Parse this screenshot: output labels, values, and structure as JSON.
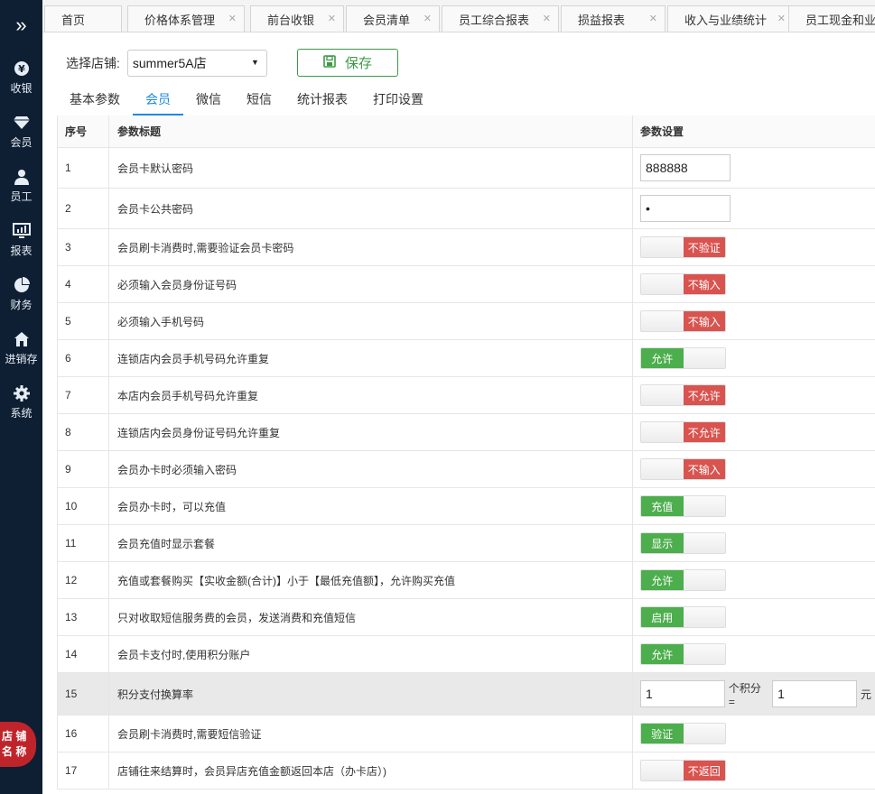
{
  "sidebar": {
    "toggle": "»",
    "items": [
      {
        "label": "收银",
        "icon": "yen-coin-icon"
      },
      {
        "label": "会员",
        "icon": "diamond-icon"
      },
      {
        "label": "员工",
        "icon": "person-icon"
      },
      {
        "label": "报表",
        "icon": "monitor-chart-icon"
      },
      {
        "label": "财务",
        "icon": "pie-chart-icon"
      },
      {
        "label": "进销存",
        "icon": "house-icon"
      },
      {
        "label": "系统",
        "icon": "gear-icon"
      }
    ],
    "store_badge": [
      "店 铺",
      "名 称"
    ]
  },
  "tabs": [
    {
      "label": "首页"
    },
    {
      "label": "价格体系管理"
    },
    {
      "label": "前台收银"
    },
    {
      "label": "会员清单"
    },
    {
      "label": "员工综合报表"
    },
    {
      "label": "损益报表"
    },
    {
      "label": "收入与业绩统计"
    },
    {
      "label": "员工现金和业绩"
    }
  ],
  "toolbar": {
    "store_label": "选择店铺:",
    "store_value": "summer5A店",
    "save_label": "保存"
  },
  "subtabs": [
    {
      "label": "基本参数",
      "active": false
    },
    {
      "label": "会员",
      "active": true
    },
    {
      "label": "微信",
      "active": false
    },
    {
      "label": "短信",
      "active": false
    },
    {
      "label": "统计报表",
      "active": false
    },
    {
      "label": "打印设置",
      "active": false
    }
  ],
  "table": {
    "headers": {
      "no": "序号",
      "title": "参数标题",
      "setting": "参数设置"
    },
    "rows": [
      {
        "no": "1",
        "title": "会员卡默认密码",
        "type": "text",
        "value": "888888"
      },
      {
        "no": "2",
        "title": "会员卡公共密码",
        "type": "text",
        "value": "•"
      },
      {
        "no": "3",
        "title": "会员刷卡消费时,需要验证会员卡密码",
        "type": "switch",
        "state": "off",
        "label": "不验证"
      },
      {
        "no": "4",
        "title": "必须输入会员身份证号码",
        "type": "switch",
        "state": "off",
        "label": "不输入"
      },
      {
        "no": "5",
        "title": "必须输入手机号码",
        "type": "switch",
        "state": "off",
        "label": "不输入"
      },
      {
        "no": "6",
        "title": "连锁店内会员手机号码允许重复",
        "type": "switch",
        "state": "on",
        "label": "允许"
      },
      {
        "no": "7",
        "title": "本店内会员手机号码允许重复",
        "type": "switch",
        "state": "off",
        "label": "不允许"
      },
      {
        "no": "8",
        "title": "连锁店内会员身份证号码允许重复",
        "type": "switch",
        "state": "off",
        "label": "不允许"
      },
      {
        "no": "9",
        "title": "会员办卡时必须输入密码",
        "type": "switch",
        "state": "off",
        "label": "不输入"
      },
      {
        "no": "10",
        "title": "会员办卡时，可以充值",
        "type": "switch",
        "state": "on",
        "label": "充值"
      },
      {
        "no": "11",
        "title": "会员充值时显示套餐",
        "type": "switch",
        "state": "on",
        "label": "显示"
      },
      {
        "no": "12",
        "title": "充值或套餐购买【实收金额(合计)】小于【最低充值额】，允许购买充值",
        "type": "switch",
        "state": "on",
        "label": "允许"
      },
      {
        "no": "13",
        "title": "只对收取短信服务费的会员，发送消费和充值短信",
        "type": "switch",
        "state": "on",
        "label": "启用"
      },
      {
        "no": "14",
        "title": "会员卡支付时,使用积分账户",
        "type": "switch",
        "state": "on",
        "label": "允许"
      },
      {
        "no": "15",
        "title": "积分支付换算率",
        "type": "rate",
        "value1": "1",
        "mid": "个积分 =",
        "value2": "1",
        "tail": "元"
      },
      {
        "no": "16",
        "title": "会员刷卡消费时,需要短信验证",
        "type": "switch",
        "state": "on",
        "label": "验证"
      },
      {
        "no": "17",
        "title": "店铺往来结算时，会员异店充值金额返回本店（办卡店）)",
        "type": "switch",
        "state": "off",
        "label": "不返回"
      }
    ]
  },
  "colors": {
    "sidebar": "#0f1f33",
    "accent": "#1e88e5",
    "on": "#4cae4c",
    "off": "#d9534f",
    "save": "#3a9b44"
  }
}
